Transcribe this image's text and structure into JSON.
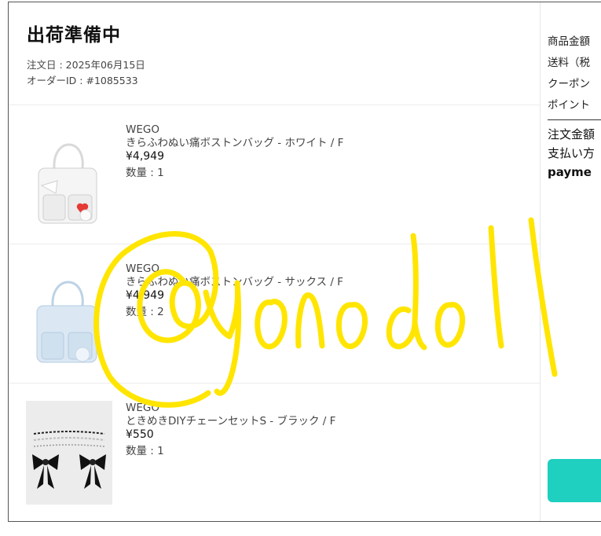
{
  "order": {
    "status_title": "出荷準備中",
    "order_date": "注文日 : 2025年06月15日",
    "order_id": "オーダーID : #1085533"
  },
  "items": [
    {
      "brand": "WEGO",
      "name": "きらふわぬい痛ボストンバッグ - ホワイト / F",
      "price": "¥4,949",
      "quantity": "数量 : 1",
      "image_icon": "white-bag-image"
    },
    {
      "brand": "WEGO",
      "name": "きらふわぬい痛ボストンバッグ - サックス / F",
      "price": "¥4,949",
      "quantity": "数量 : 2",
      "image_icon": "blue-bag-image"
    },
    {
      "brand": "WEGO",
      "name": "ときめきDIYチェーンセットS - ブラック / F",
      "price": "¥550",
      "quantity": "数量 : 1",
      "image_icon": "chain-ribbon-image"
    }
  ],
  "summary": {
    "subtotal_label": "商品金額",
    "shipping_label": "送料（税",
    "coupon_label": "クーポン",
    "points_label": "ポイント",
    "total_label": "注文金額",
    "payment_label": "支払い方",
    "payment_value": "payme"
  },
  "watermark": {
    "text": "@yonodoll",
    "color": "#ffe500"
  },
  "colors": {
    "accent": "#1fcfc0"
  }
}
